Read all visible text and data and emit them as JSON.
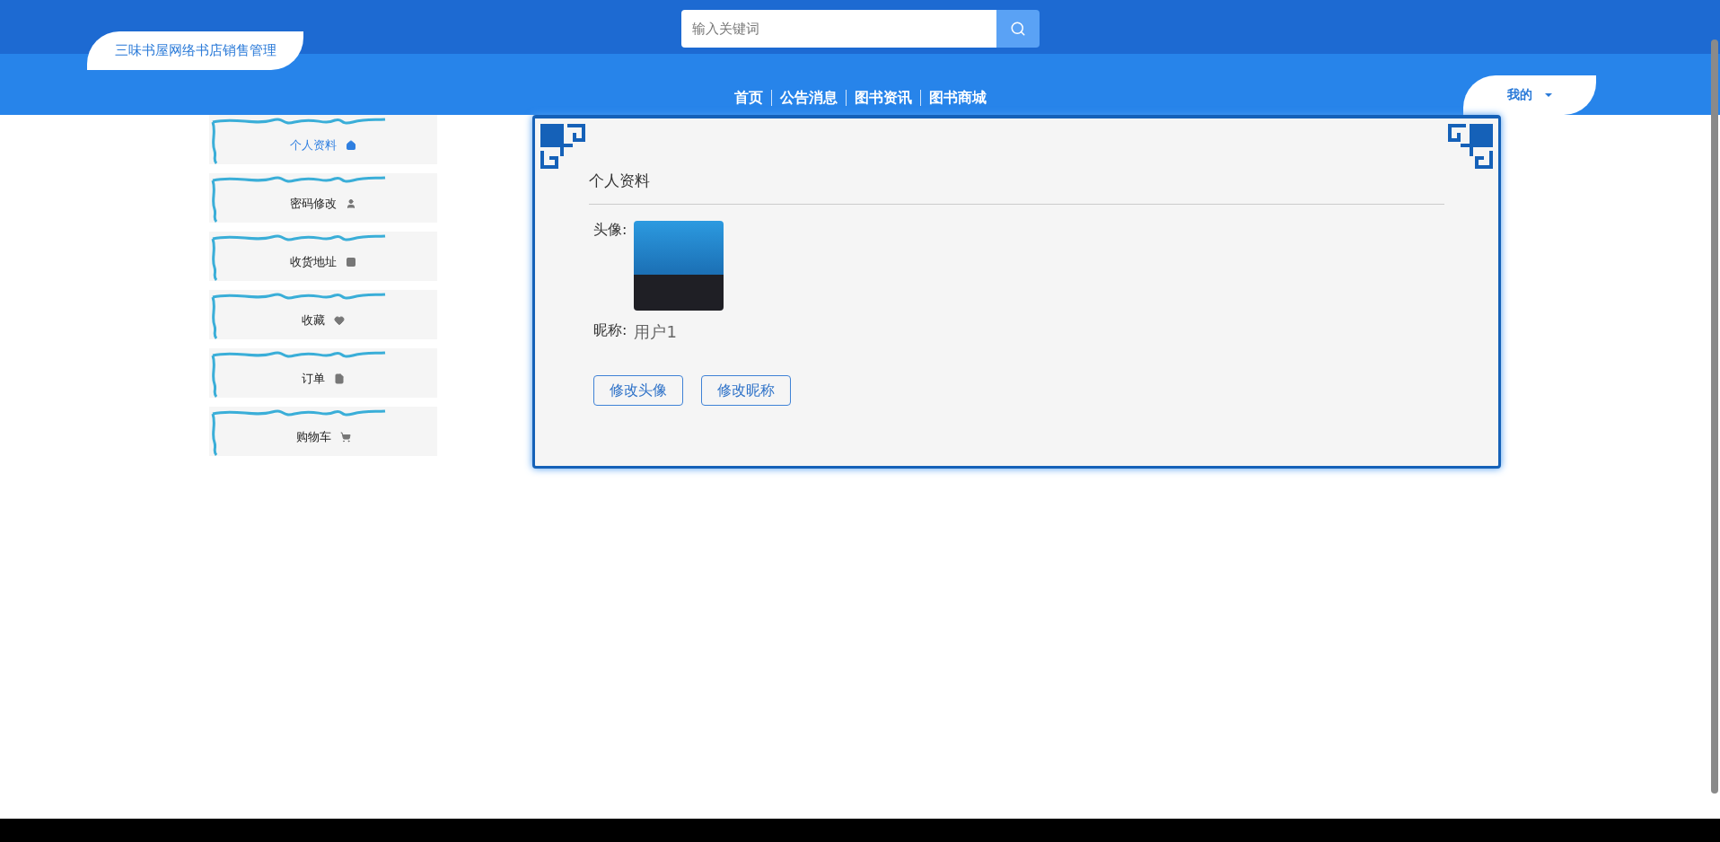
{
  "header": {
    "site_title": "三味书屋网络书店销售管理",
    "search": {
      "placeholder": "输入关键词"
    }
  },
  "nav": [
    {
      "label": "首页"
    },
    {
      "label": "公告消息"
    },
    {
      "label": "图书资讯"
    },
    {
      "label": "图书商城"
    }
  ],
  "user_menu": {
    "label": "我的"
  },
  "sidebar": {
    "items": [
      {
        "label": "个人资料",
        "selected": true
      },
      {
        "label": "密码修改",
        "selected": false
      },
      {
        "label": "收货地址",
        "selected": false
      },
      {
        "label": "收藏",
        "selected": false
      },
      {
        "label": "订单",
        "selected": false
      },
      {
        "label": "购物车",
        "selected": false
      }
    ]
  },
  "profile": {
    "title": "个人资料",
    "avatar_label": "头像:",
    "nickname_label": "昵称:",
    "nickname_value": "用户1",
    "buttons": [
      {
        "label": "修改头像"
      },
      {
        "label": "修改昵称"
      }
    ]
  }
}
